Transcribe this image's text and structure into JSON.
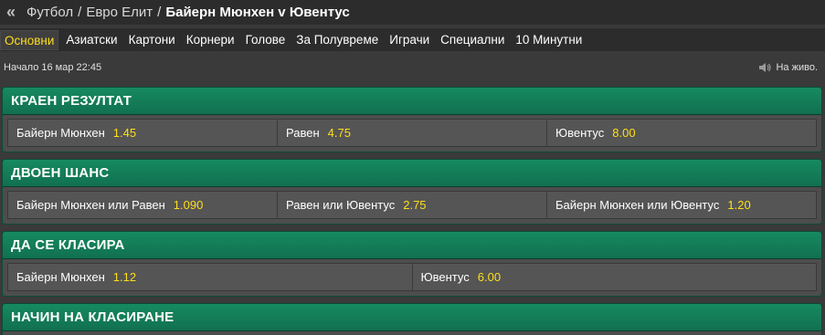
{
  "header": {
    "back_icon": "double-chevron-left-icon",
    "crumbs": [
      "Футбол",
      "Евро Елит"
    ],
    "separator": "/",
    "current": "Байерн Мюнхен v Ювентус"
  },
  "tabs": [
    {
      "label": "Основни",
      "active": true
    },
    {
      "label": "Азиатски"
    },
    {
      "label": "Картони"
    },
    {
      "label": "Корнери"
    },
    {
      "label": "Голове"
    },
    {
      "label": "За Полувреме"
    },
    {
      "label": "Играчи"
    },
    {
      "label": "Специални"
    },
    {
      "label": "10 Минутни"
    }
  ],
  "info": {
    "start_time": "Начало 16 мар 22:45",
    "live_icon": "speaker-icon",
    "live_label": "На живо."
  },
  "markets": [
    {
      "title": "КРАЕН РЕЗУЛТАТ",
      "selections": [
        {
          "name": "Байерн Мюнхен",
          "odds": "1.45"
        },
        {
          "name": "Равен",
          "odds": "4.75"
        },
        {
          "name": "Ювентус",
          "odds": "8.00"
        }
      ]
    },
    {
      "title": "ДВОЕН ШАНС",
      "selections": [
        {
          "name": "Байерн Мюнхен или Равен",
          "odds": "1.090"
        },
        {
          "name": "Равен или Ювентус",
          "odds": "2.75"
        },
        {
          "name": "Байерн Мюнхен или Ювентус",
          "odds": "1.20"
        }
      ]
    },
    {
      "title": "ДА СЕ КЛАСИРА",
      "selections": [
        {
          "name": "Байерн Мюнхен",
          "odds": "1.12"
        },
        {
          "name": "Ювентус",
          "odds": "6.00"
        }
      ]
    },
    {
      "title": "НАЧИН НА КЛАСИРАНЕ",
      "selections": []
    }
  ],
  "colors": {
    "odds": "#ffdf1b",
    "market_header": "#168a60",
    "background": "#3a3a3a"
  }
}
